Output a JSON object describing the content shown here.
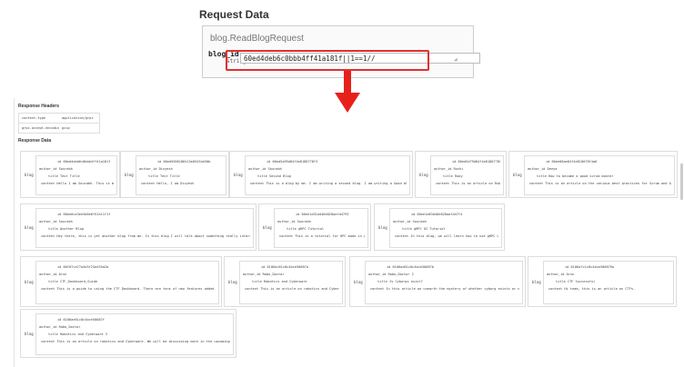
{
  "request": {
    "title": "Request Data",
    "service": "blog.ReadBlogRequest",
    "field_name": "blog_id",
    "field_type": "string",
    "field_value": "60ed4deb6c0bbb4ff41a181f||1==1//",
    "checkbox_checked": true
  },
  "response": {
    "headers_label": "Response Headers",
    "headers": [
      {
        "key": "content-type",
        "value": "application/grpc"
      },
      {
        "key": "grpc-accept-encoding",
        "value": "gzip"
      }
    ],
    "data_label": "Response Data",
    "blogs": [
      {
        "label": "blog",
        "id": "60ed4deb6c0bbb4ff41a181f",
        "author_id": "Sourabh",
        "title": "Test Title",
        "content": "Hello I am Sourabh. This is my first blog"
      },
      {
        "label": "blog",
        "id": "60ed5056186415e05454e50b",
        "author_id": "Divyesh",
        "title": "Test Title",
        "content": "Hello, I am Divyesh"
      },
      {
        "label": "blog",
        "id": "60ed5a95d84f4e8180778f3",
        "author_id": "Sourabh",
        "title": "Second Blog",
        "content": "This is a blog by me. I am writing a second blog. I am writing a Good blog."
      },
      {
        "label": "blog",
        "id": "60ed5d79d84f4e8180778f3e",
        "author_id": "Ruchi",
        "title": "Ruby",
        "content": "This is an article on Ruby"
      },
      {
        "label": "blog",
        "id": "60ee08ae84f4e818078f4a6",
        "author_id": "Deeya",
        "title": "How to become a good scrum master",
        "content": "This is an article on the various best practices for Scrum and Agile"
      },
      {
        "label": "blog",
        "id": "60ee0ce3ee3d6e6f51e11f1f",
        "author_id": "Sourabh",
        "title": "Another Blog",
        "content": "Hey there, this is yet another blog from me. In this blog I will talk about something really interesting."
      },
      {
        "label": "blog",
        "id": "60ee1d31ad40e828aafd4793",
        "author_id": "Sourabh",
        "title": "gRPC Tutorial",
        "content": "This is a tutorial for RPC made in gRPC"
      },
      {
        "label": "blog",
        "id": "60ee1d63d40e828aafd47f4",
        "author_id": "Sourabh",
        "title": "gRPC UI Tutorial",
        "content": "In this blog, we will learn how to use gRPC UI."
      },
      {
        "label": "blog",
        "id": "60f07ca77a4e5f25a455a2b",
        "author_id": "Arun",
        "title": "CTF_Dashboard_Guide",
        "content": "This is a guide to using the CTF Dashboard. There are tons of new features added here!"
      },
      {
        "label": "blog",
        "id": "6106ac61c8c4bce50087a",
        "author_id": "Robo_Doctor",
        "title": "Robotics and Cyberware",
        "content": "This is an article on robotics and Cyberware"
      },
      {
        "label": "blog",
        "id": "6106ad61c8c4bce50087b",
        "author_id": "Robo_Doctor 2",
        "title": "Is Cyborgs exist?",
        "content": "In this article we unearth the mystery of whether cyborg exists or not"
      },
      {
        "label": "blog",
        "id": "6106afc1c8c4bce500879a",
        "author_id": "Arun",
        "title": "CTF Successful",
        "content": "Hi team, this is an article on CTFs."
      },
      {
        "label": "blog",
        "id": "6106ae61c8c4bce50087f",
        "author_id": "Robo_Doctor",
        "title": "Robotics and Cyberware 3",
        "content": "This is an article on robotics and Cyberware. We will be discussing more in the upcoming blogs."
      }
    ]
  }
}
